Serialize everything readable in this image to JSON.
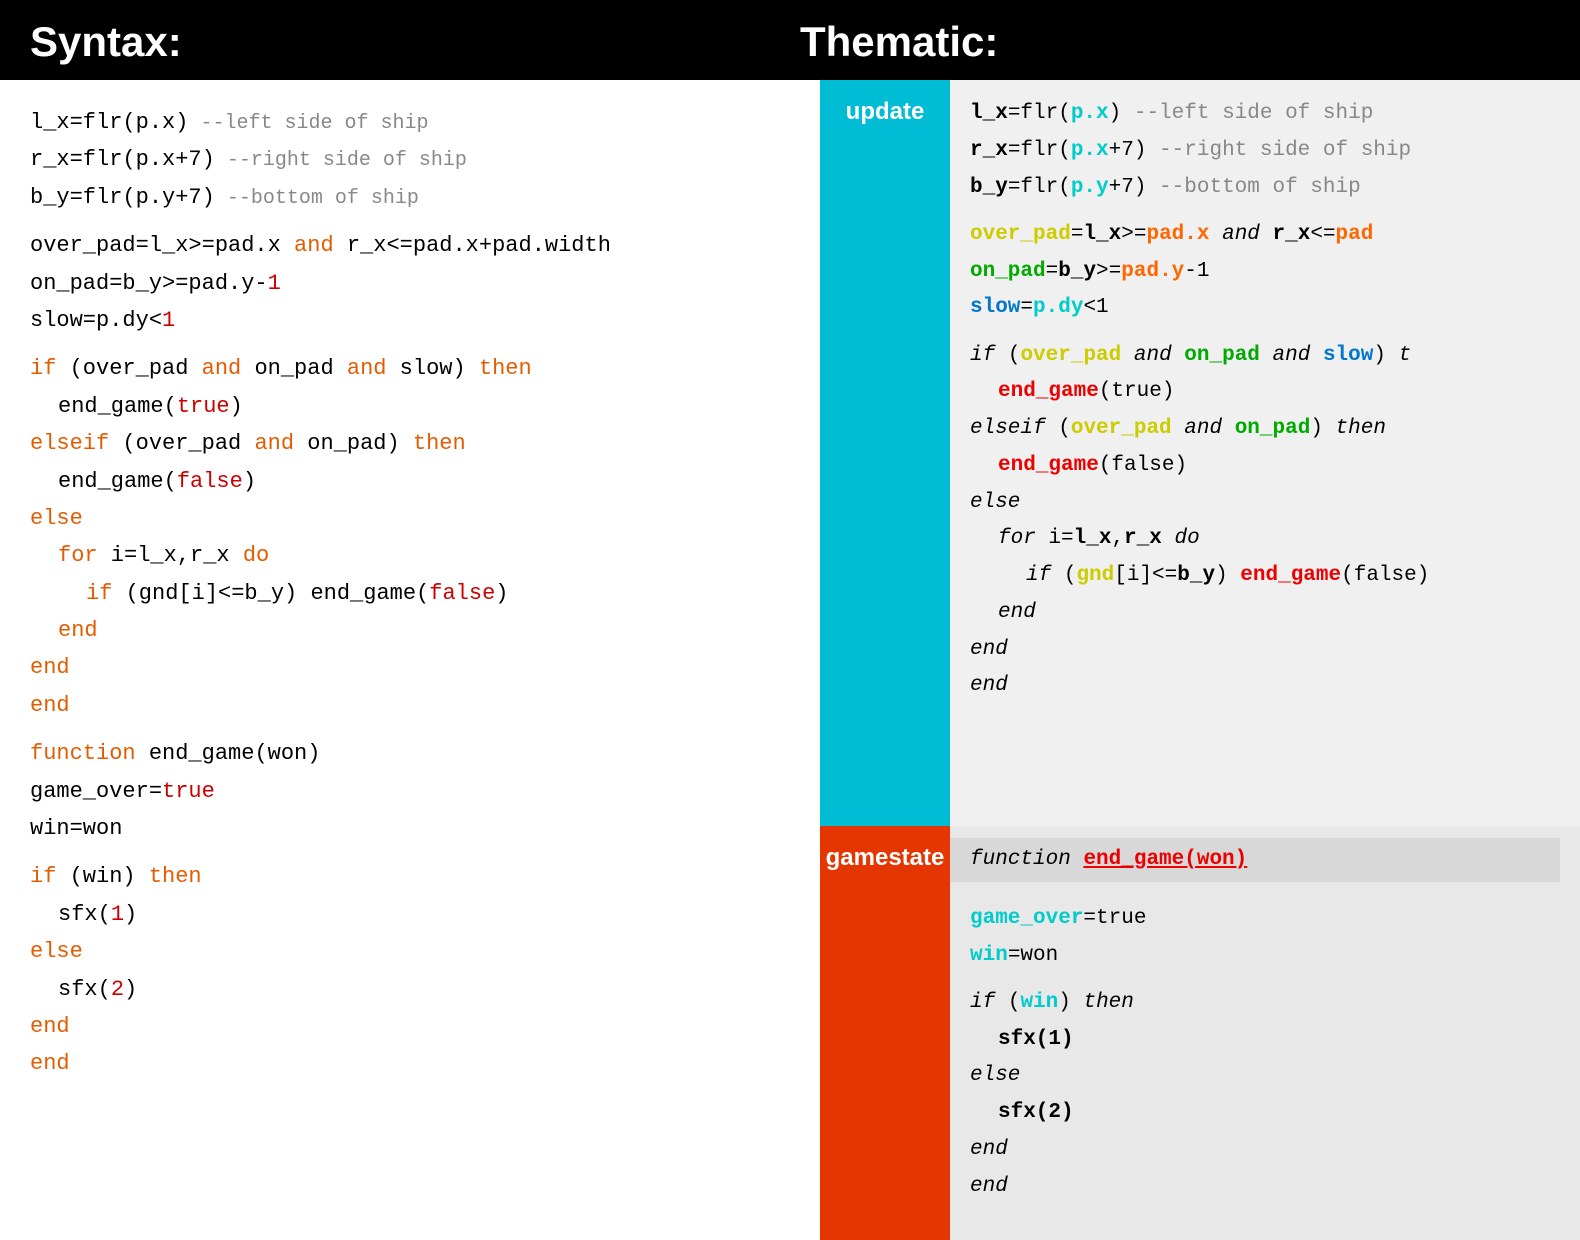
{
  "header": {
    "syntax_title": "Syntax:",
    "thematic_title": "Thematic:"
  },
  "syntax": {
    "lines": [
      "l_x=flr(p.x)   --left side of ship",
      "r_x=flr(p.x+7) --right side of ship",
      "b_y=flr(p.y+7) --bottom of ship",
      "",
      "over_pad=l_x>=pad.x and r_x<=pad.x+pad.width",
      "on_pad=b_y>=pad.y-1",
      "slow=p.dy<1",
      "",
      "if (over_pad and on_pad and slow) then",
      " end_game(true)",
      "elseif (over_pad and on_pad) then",
      " end_game(false)",
      "else",
      " for i=l_x,r_x do",
      "  if (gnd[i]<=b_y) end_game(false)",
      " end",
      "end",
      "end",
      "",
      "function end_game(won)",
      "game_over=true",
      "win=won",
      "",
      "if (win) then",
      " sfx(1)",
      "else",
      " sfx(2)",
      "end",
      "end"
    ]
  },
  "thematic": {
    "update_label": "update",
    "gamestate_label": "gamestate"
  }
}
